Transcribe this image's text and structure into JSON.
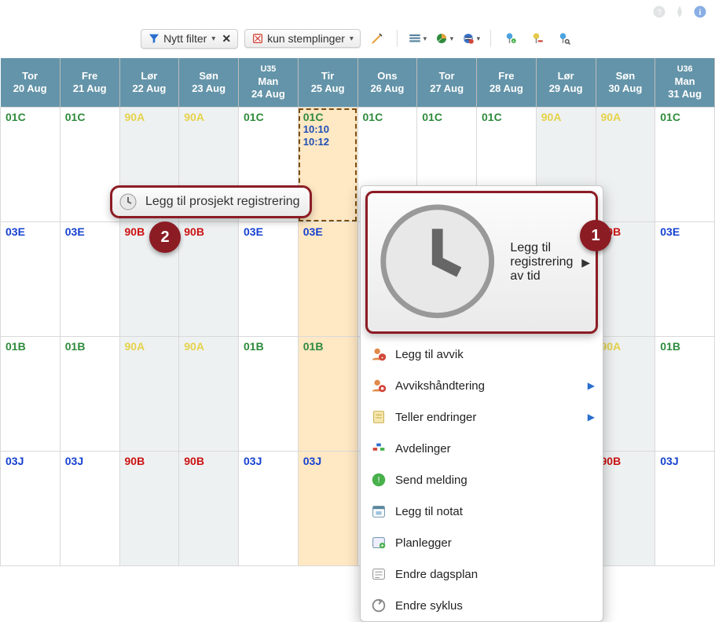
{
  "top_icons": [
    "help-icon",
    "pin-icon",
    "info-icon"
  ],
  "toolbar": {
    "filter_label": "Nytt filter",
    "stamp_label": "kun stemplinger"
  },
  "calendar": {
    "week_labels": [
      "U35"
    ],
    "next_week_label": "U36",
    "headers": [
      {
        "dow": "Tor",
        "date": "20 Aug",
        "cls": ""
      },
      {
        "dow": "Fre",
        "date": "21 Aug",
        "cls": ""
      },
      {
        "dow": "Lør",
        "date": "22 Aug",
        "cls": "weekend"
      },
      {
        "dow": "Søn",
        "date": "23 Aug",
        "cls": "weekend"
      },
      {
        "dow": "Man",
        "date": "24 Aug",
        "cls": "",
        "week": "U35"
      },
      {
        "dow": "Tir",
        "date": "25 Aug",
        "cls": "highlight-col"
      },
      {
        "dow": "Ons",
        "date": "26 Aug",
        "cls": ""
      },
      {
        "dow": "Tor",
        "date": "27 Aug",
        "cls": ""
      },
      {
        "dow": "Fre",
        "date": "28 Aug",
        "cls": ""
      },
      {
        "dow": "Lør",
        "date": "29 Aug",
        "cls": "weekend"
      },
      {
        "dow": "Søn",
        "date": "30 Aug",
        "cls": "weekend"
      },
      {
        "dow": "Man",
        "date": "31 Aug",
        "cls": "",
        "week": "U36"
      }
    ],
    "rows": [
      [
        {
          "text": "01C",
          "color": "green"
        },
        {
          "text": "01C",
          "color": "green"
        },
        {
          "text": "90A",
          "color": "yellow"
        },
        {
          "text": "90A",
          "color": "yellow"
        },
        {
          "text": "01C",
          "color": "green"
        },
        {
          "text": "01C",
          "color": "green",
          "times": [
            "10:10",
            "10:12"
          ],
          "dashed": true
        },
        {
          "text": "01C",
          "color": "green"
        },
        {
          "text": "01C",
          "color": "green"
        },
        {
          "text": "01C",
          "color": "green"
        },
        {
          "text": "90A",
          "color": "yellow"
        },
        {
          "text": "90A",
          "color": "yellow"
        },
        {
          "text": "01C",
          "color": "green"
        }
      ],
      [
        {
          "text": "03E",
          "color": "blue"
        },
        {
          "text": "03E",
          "color": "blue"
        },
        {
          "text": "90B",
          "color": "red"
        },
        {
          "text": "90B",
          "color": "red"
        },
        {
          "text": "03E",
          "color": "blue"
        },
        {
          "text": "03E",
          "color": "blue"
        },
        {
          "text": "",
          "color": ""
        },
        {
          "text": "",
          "color": ""
        },
        {
          "text": "",
          "color": ""
        },
        {
          "text": "",
          "color": ""
        },
        {
          "text": "90B",
          "color": "red"
        },
        {
          "text": "03E",
          "color": "blue"
        }
      ],
      [
        {
          "text": "01B",
          "color": "green"
        },
        {
          "text": "01B",
          "color": "green"
        },
        {
          "text": "90A",
          "color": "yellow"
        },
        {
          "text": "90A",
          "color": "yellow"
        },
        {
          "text": "01B",
          "color": "green"
        },
        {
          "text": "01B",
          "color": "green"
        },
        {
          "text": "",
          "color": ""
        },
        {
          "text": "",
          "color": ""
        },
        {
          "text": "",
          "color": ""
        },
        {
          "text": "",
          "color": ""
        },
        {
          "text": "90A",
          "color": "yellow"
        },
        {
          "text": "01B",
          "color": "green"
        }
      ],
      [
        {
          "text": "03J",
          "color": "blue"
        },
        {
          "text": "03J",
          "color": "blue"
        },
        {
          "text": "90B",
          "color": "red"
        },
        {
          "text": "90B",
          "color": "red"
        },
        {
          "text": "03J",
          "color": "blue"
        },
        {
          "text": "03J",
          "color": "blue"
        },
        {
          "text": "",
          "color": ""
        },
        {
          "text": "",
          "color": ""
        },
        {
          "text": "",
          "color": ""
        },
        {
          "text": "",
          "color": ""
        },
        {
          "text": "90B",
          "color": "red"
        },
        {
          "text": "03J",
          "color": "blue"
        }
      ]
    ]
  },
  "context_menu": {
    "first": "Legg til registrering av tid",
    "items": [
      {
        "label": "Legg til avvik",
        "icon": "user-red-icon"
      },
      {
        "label": "Avvikshåndtering",
        "icon": "user-gear-icon",
        "sub": true
      },
      {
        "label": "Teller endringer",
        "icon": "note-icon",
        "sub": true
      },
      {
        "label": "Avdelinger",
        "icon": "dept-icon"
      },
      {
        "label": "Send melding",
        "icon": "chat-icon"
      },
      {
        "label": "Legg til notat",
        "icon": "calendar-note-icon"
      },
      {
        "label": "Planlegger",
        "icon": "planner-icon"
      },
      {
        "label": "Endre dagsplan",
        "icon": "dayplan-icon"
      },
      {
        "label": "Endre syklus",
        "icon": "cycle-icon"
      }
    ]
  },
  "submenu": {
    "label": "Legg til prosjekt registrering"
  },
  "callouts": {
    "one": "1",
    "two": "2"
  }
}
